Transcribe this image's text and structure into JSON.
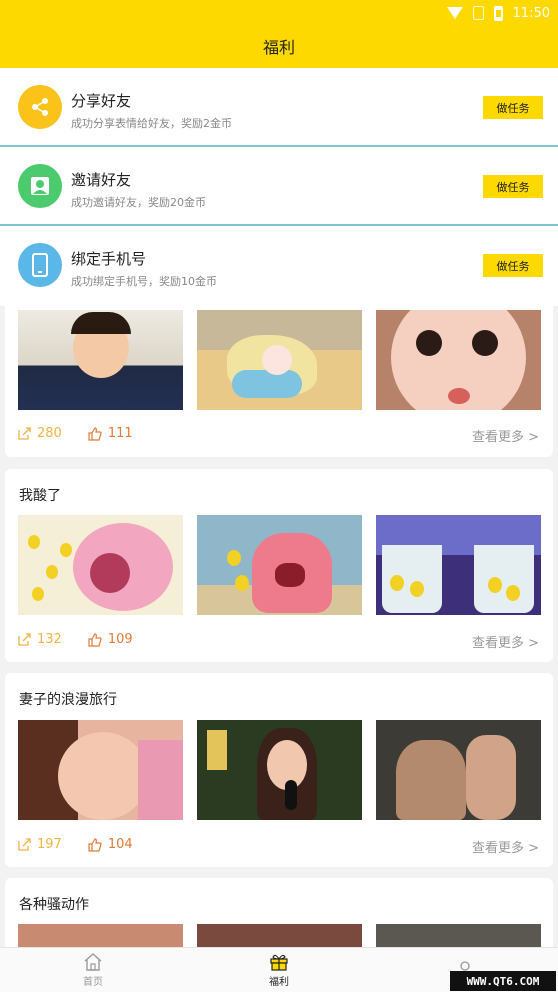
{
  "status_bar": {
    "time": "11:50"
  },
  "header": {
    "title": "福利"
  },
  "tasks": [
    {
      "title": "分享好友",
      "desc": "成功分享表情给好友，奖励2金币",
      "button": "做任务",
      "icon": "share-icon",
      "color": "#fbc21a"
    },
    {
      "title": "邀请好友",
      "desc": "成功邀请好友，奖励20金币",
      "button": "做任务",
      "icon": "person-icon",
      "color": "#4bcb6e"
    },
    {
      "title": "绑定手机号",
      "desc": "成功绑定手机号，奖励10金币",
      "button": "做任务",
      "icon": "phone-icon",
      "color": "#5cb7e9"
    }
  ],
  "cards": [
    {
      "title": "",
      "shares": "280",
      "likes": "111",
      "more": "查看更多 >"
    },
    {
      "title": "我酸了",
      "shares": "132",
      "likes": "109",
      "more": "查看更多 >"
    },
    {
      "title": "妻子的浪漫旅行",
      "shares": "197",
      "likes": "104",
      "more": "查看更多 >"
    },
    {
      "title": "各种骚动作"
    }
  ],
  "bottom_nav": [
    {
      "label": "首页",
      "icon": "home-icon"
    },
    {
      "label": "福利",
      "icon": "gift-icon"
    },
    {
      "label": "",
      "icon": "profile-icon"
    }
  ],
  "watermark": "WWW.QT6.COM",
  "colors": {
    "accent": "#fdd900",
    "share": "#f0b444",
    "like": "#e07b3a"
  }
}
